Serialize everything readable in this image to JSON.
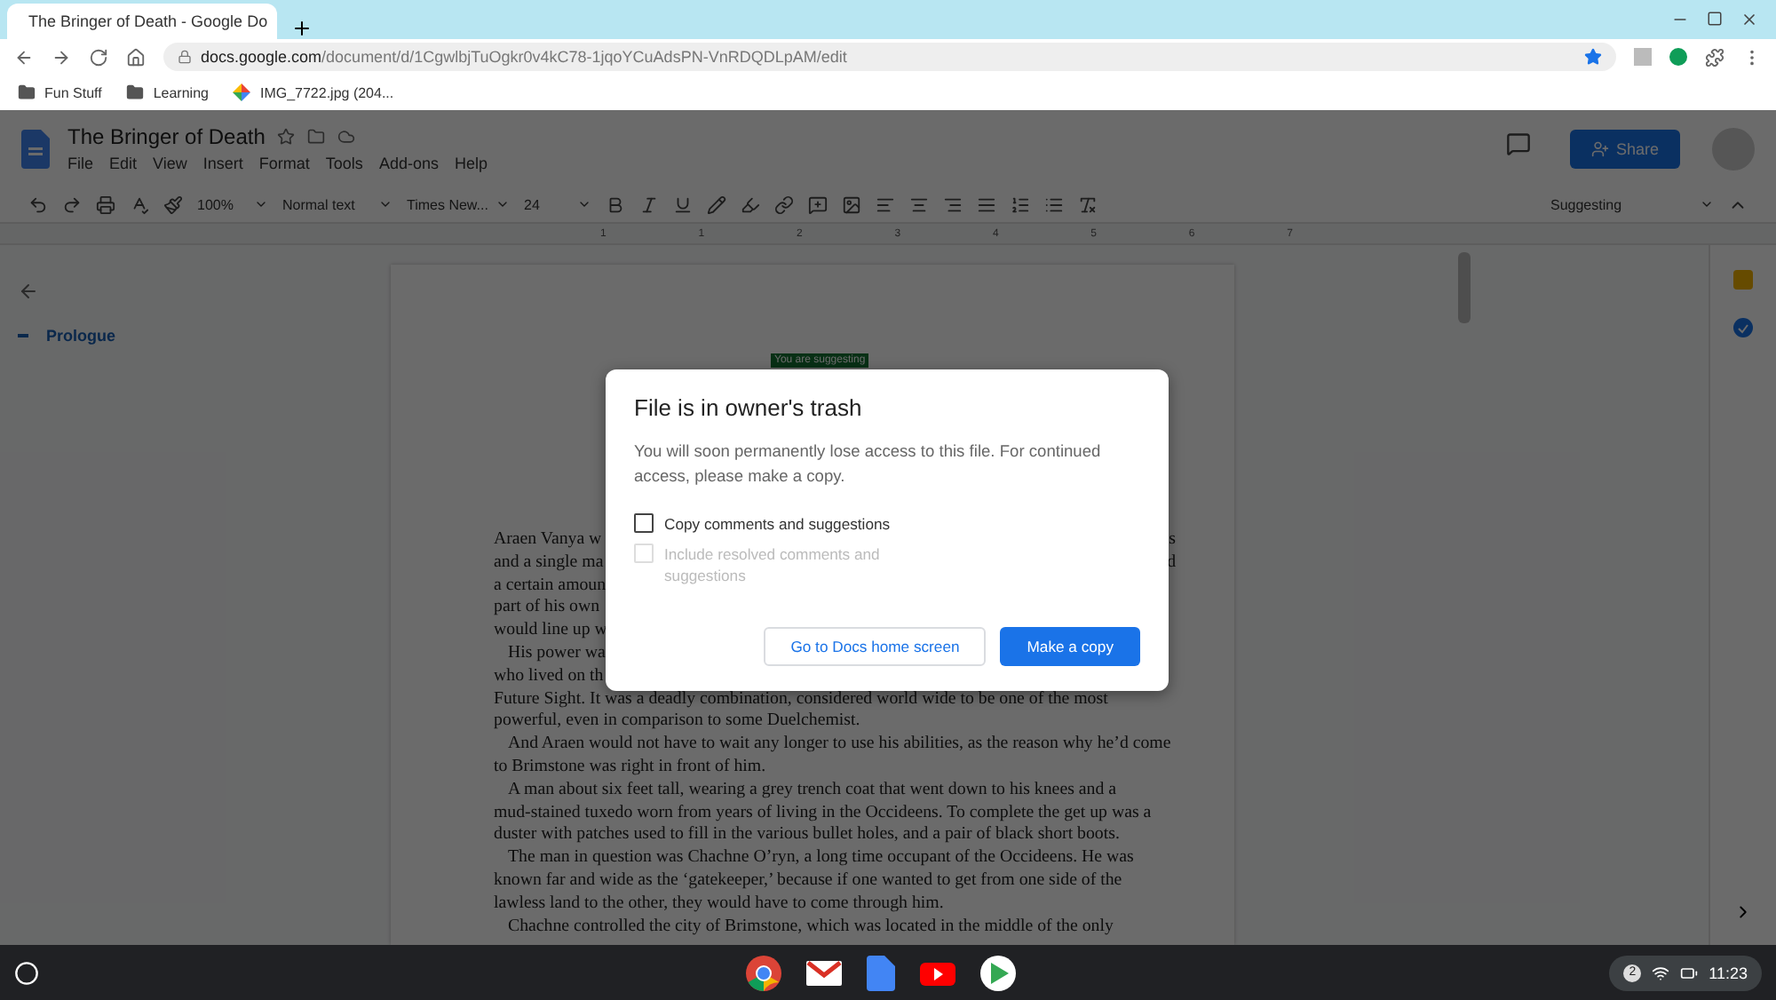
{
  "browser": {
    "tab": {
      "title": "The Bringer of Death - Google Do",
      "selected": true
    },
    "url": {
      "host": "docs.google.com",
      "path": "/document/d/1CgwlbjTuOgkr0v4kC78-1jqoYCuAdsPN-VnRDQDLpAM/edit"
    },
    "bookmarks": [
      {
        "kind": "folder",
        "label": "Fun Stuff"
      },
      {
        "kind": "folder",
        "label": "Learning"
      },
      {
        "kind": "photo",
        "label": "IMG_7722.jpg (204..."
      }
    ]
  },
  "doc": {
    "title": "The Bringer of Death",
    "menu": [
      "File",
      "Edit",
      "View",
      "Insert",
      "Format",
      "Tools",
      "Add-ons",
      "Help"
    ],
    "share": "Share",
    "toolbar": {
      "zoom": "100%",
      "style": "Normal text",
      "font": "Times New...",
      "size": "24",
      "mode": "Suggesting"
    },
    "ruler": [
      "1",
      "1",
      "2",
      "3",
      "4",
      "5",
      "6",
      "7"
    ],
    "outline": [
      {
        "label": "Prologue",
        "selected": true
      }
    ],
    "badge": "You are suggesting",
    "paragraphs": [
      {
        "lines": [
          {
            "text": "Araen Vanya w",
            "tail": "s"
          },
          {
            "text": "and a single ma",
            "tail": "d"
          },
          {
            "text": "a certain amoun"
          },
          {
            "text": "part of his own"
          },
          {
            "text": "would line up w"
          }
        ]
      },
      {
        "lines": [
          {
            "text": "His power wa"
          },
          {
            "text": "who lived on th"
          },
          {
            "text": "Future Sight. It was a deadly combination, considered world wide to be one of the most"
          },
          {
            "text": "powerful, even in comparison to some Duelchemist."
          }
        ]
      },
      {
        "lines": [
          {
            "text": "And Araen would not have to wait any longer to use his abilities, as the reason why he’d come"
          },
          {
            "text": "to Brimstone was right in front of him."
          }
        ]
      },
      {
        "lines": [
          {
            "text": "A man about six feet tall, wearing a grey trench coat that went down to his knees and a"
          },
          {
            "text": "mud-stained tuxedo worn from years of living in the Occideens. To complete the get up was a"
          },
          {
            "text": "duster with patches used to fill in the various bullet holes, and a pair of black short boots."
          }
        ]
      },
      {
        "lines": [
          {
            "text": "The man in question was Chachne O’ryn, a long time occupant of the Occideens. He was"
          },
          {
            "text": "known far and wide as the ‘gatekeeper,’ because if one wanted to get from one side of the"
          },
          {
            "text": "lawless land to the other, they would have to come through him."
          }
        ]
      },
      {
        "lines": [
          {
            "text": "Chachne controlled the city of Brimstone, which was located in the middle of the only"
          }
        ]
      }
    ]
  },
  "dialog": {
    "title": "File is in owner's trash",
    "body": "You will soon permanently lose access to this file. For continued access, please make a copy.",
    "options": [
      {
        "label": "Copy comments and suggestions",
        "checked": false,
        "disabled": false
      },
      {
        "label": "Include resolved comments and suggestions",
        "checked": false,
        "disabled": true
      }
    ],
    "secondary": "Go to Docs home screen",
    "primary": "Make a copy"
  },
  "taskbar": {
    "notifications": "2",
    "time": "11:23"
  }
}
